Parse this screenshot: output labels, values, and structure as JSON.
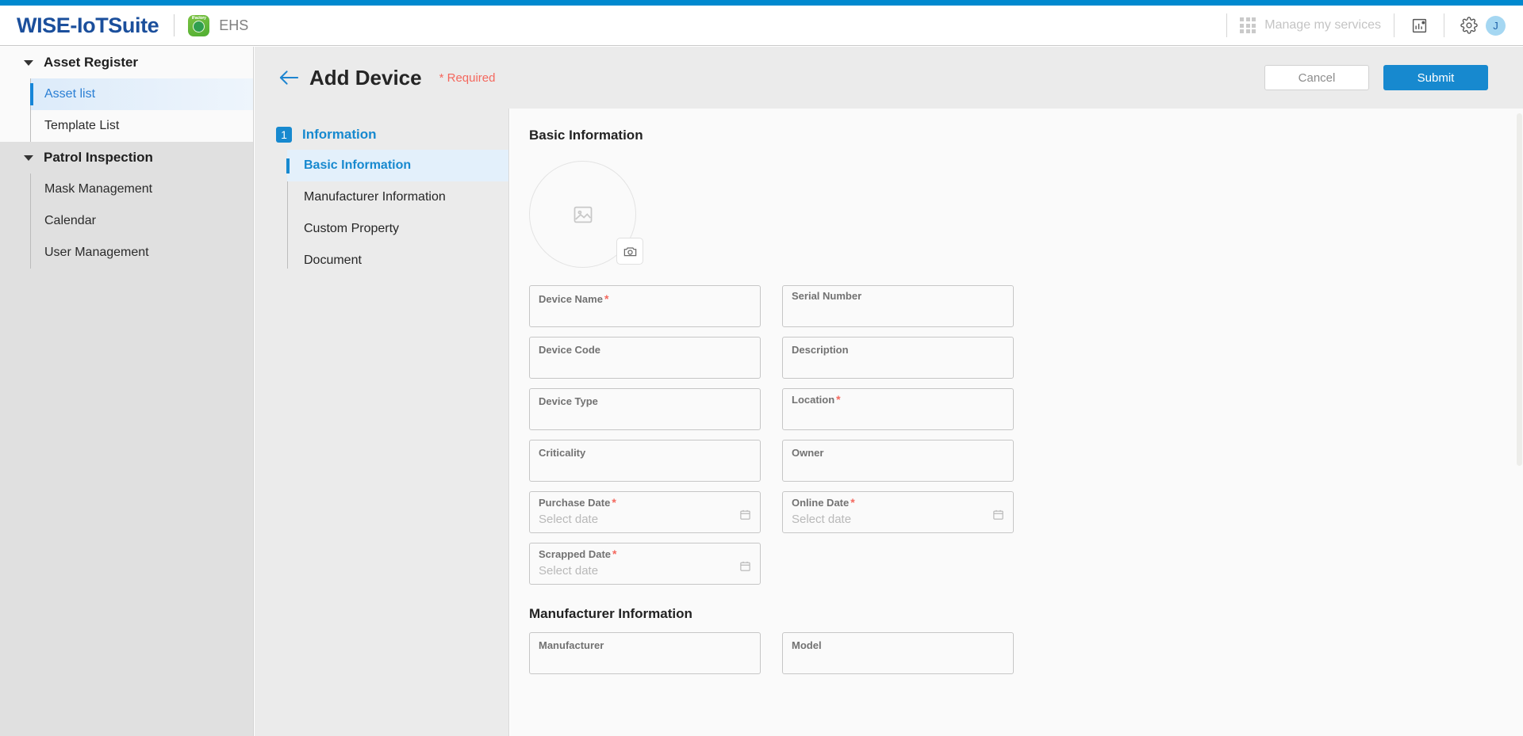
{
  "header": {
    "brand": "WISE-IoTSuite",
    "app_badge_tagline": "iFactory",
    "app_name": "EHS",
    "manage_services_label": "Manage my services",
    "analytics_icon": "chart-icon",
    "settings_icon": "gear-icon",
    "avatar_initial": "J",
    "accent_color": "#0089cf",
    "brand_color": "#1b4f9c"
  },
  "sidebar": {
    "groups": [
      {
        "label": "Asset Register",
        "items": [
          {
            "label": "Asset list",
            "active": true
          },
          {
            "label": "Template List",
            "active": false
          }
        ]
      },
      {
        "label": "Patrol Inspection",
        "items": [
          {
            "label": "Mask Management",
            "active": false
          },
          {
            "label": "Calendar",
            "active": false
          },
          {
            "label": "User Management",
            "active": false
          }
        ]
      }
    ]
  },
  "page": {
    "back_icon": "arrow-left-icon",
    "title": "Add Device",
    "required_note": "* Required",
    "cancel_label": "Cancel",
    "submit_label": "Submit",
    "submit_color": "#1789cf"
  },
  "steps": {
    "number": "1",
    "title": "Information",
    "items": [
      {
        "label": "Basic Information",
        "active": true
      },
      {
        "label": "Manufacturer Information",
        "active": false
      },
      {
        "label": "Custom Property",
        "active": false
      },
      {
        "label": "Document",
        "active": false
      }
    ]
  },
  "form": {
    "basic_section_title": "Basic Information",
    "avatar": {
      "placeholder_icon": "image-placeholder-icon",
      "camera_icon": "camera-icon"
    },
    "fields": [
      {
        "label": "Device Name",
        "required": true,
        "value": "",
        "placeholder": "",
        "type": "text"
      },
      {
        "label": "Serial Number",
        "required": false,
        "value": "",
        "placeholder": "",
        "type": "text"
      },
      {
        "label": "Device Code",
        "required": false,
        "value": "",
        "placeholder": "",
        "type": "text"
      },
      {
        "label": "Description",
        "required": false,
        "value": "",
        "placeholder": "",
        "type": "text"
      },
      {
        "label": "Device Type",
        "required": false,
        "value": "",
        "placeholder": "",
        "type": "text"
      },
      {
        "label": "Location",
        "required": true,
        "value": "",
        "placeholder": "",
        "type": "text"
      },
      {
        "label": "Criticality",
        "required": false,
        "value": "",
        "placeholder": "",
        "type": "text"
      },
      {
        "label": "Owner",
        "required": false,
        "value": "",
        "placeholder": "",
        "type": "text"
      },
      {
        "label": "Purchase Date",
        "required": true,
        "value": "Select date",
        "placeholder": "Select date",
        "type": "date"
      },
      {
        "label": "Online Date",
        "required": true,
        "value": "Select date",
        "placeholder": "Select date",
        "type": "date"
      },
      {
        "label": "Scrapped Date",
        "required": true,
        "value": "Select date",
        "placeholder": "Select date",
        "type": "date"
      }
    ],
    "manufacturer_section_title": "Manufacturer Information",
    "manufacturer_fields": [
      {
        "label": "Manufacturer",
        "required": false,
        "value": "",
        "placeholder": "",
        "type": "text"
      },
      {
        "label": "Model",
        "required": false,
        "value": "",
        "placeholder": "",
        "type": "text"
      }
    ]
  }
}
